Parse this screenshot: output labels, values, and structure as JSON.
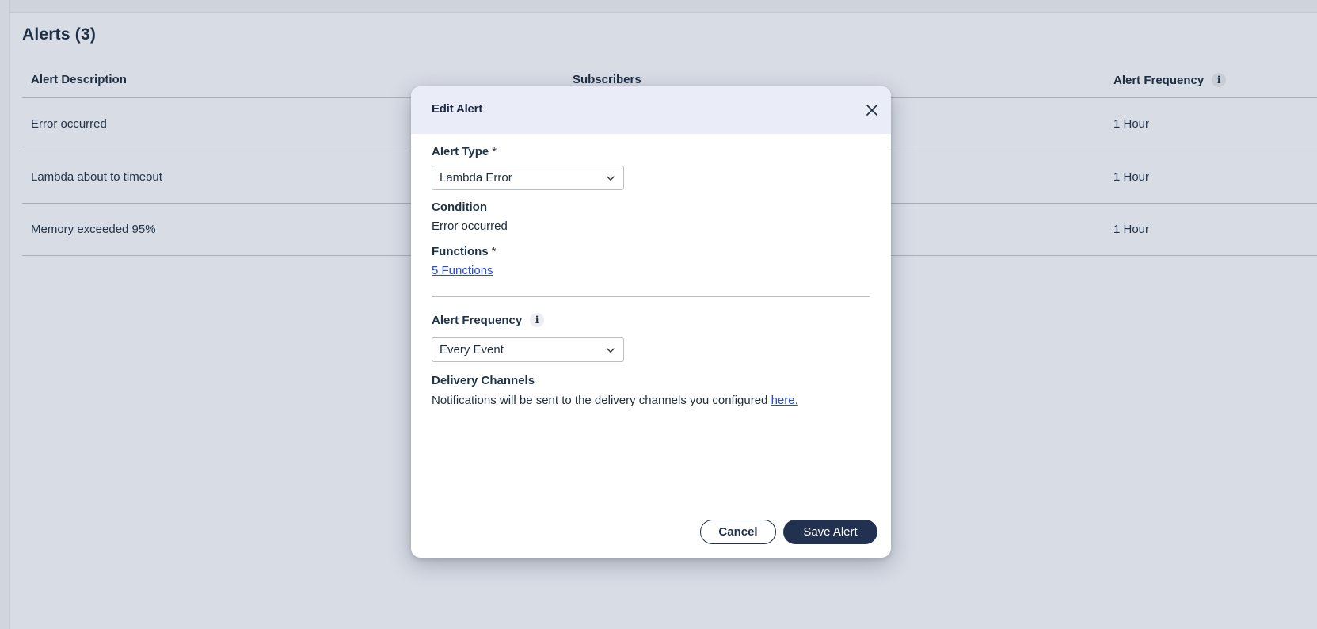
{
  "page": {
    "title": "Alerts (3)"
  },
  "table": {
    "headers": {
      "description": "Alert Description",
      "subscribers": "Subscribers",
      "frequency": "Alert Frequency",
      "frequency_info": "i"
    },
    "rows": [
      {
        "description": "Error occurred",
        "frequency": "1 Hour"
      },
      {
        "description": "Lambda about to timeout",
        "frequency": "1 Hour"
      },
      {
        "description": "Memory exceeded 95%",
        "frequency": "1 Hour"
      }
    ]
  },
  "modal": {
    "title": "Edit Alert",
    "alert_type": {
      "label": "Alert Type",
      "required_mark": "*",
      "selected": "Lambda Error"
    },
    "condition": {
      "label": "Condition",
      "value": "Error occurred"
    },
    "functions": {
      "label": "Functions",
      "required_mark": "*",
      "link": "5 Functions"
    },
    "alert_frequency": {
      "label": "Alert Frequency",
      "info": "i",
      "selected": "Every Event"
    },
    "delivery_channels": {
      "label": "Delivery Channels",
      "text": "Notifications will be sent to the delivery channels you configured ",
      "link": "here."
    },
    "buttons": {
      "cancel": "Cancel",
      "save": "Save Alert"
    }
  },
  "colors": {
    "background": "#d8dce5",
    "heading": "#1e2f45",
    "modal_header": "#eaecf8",
    "primary_button": "#22314f",
    "link": "#2a4bd6"
  }
}
